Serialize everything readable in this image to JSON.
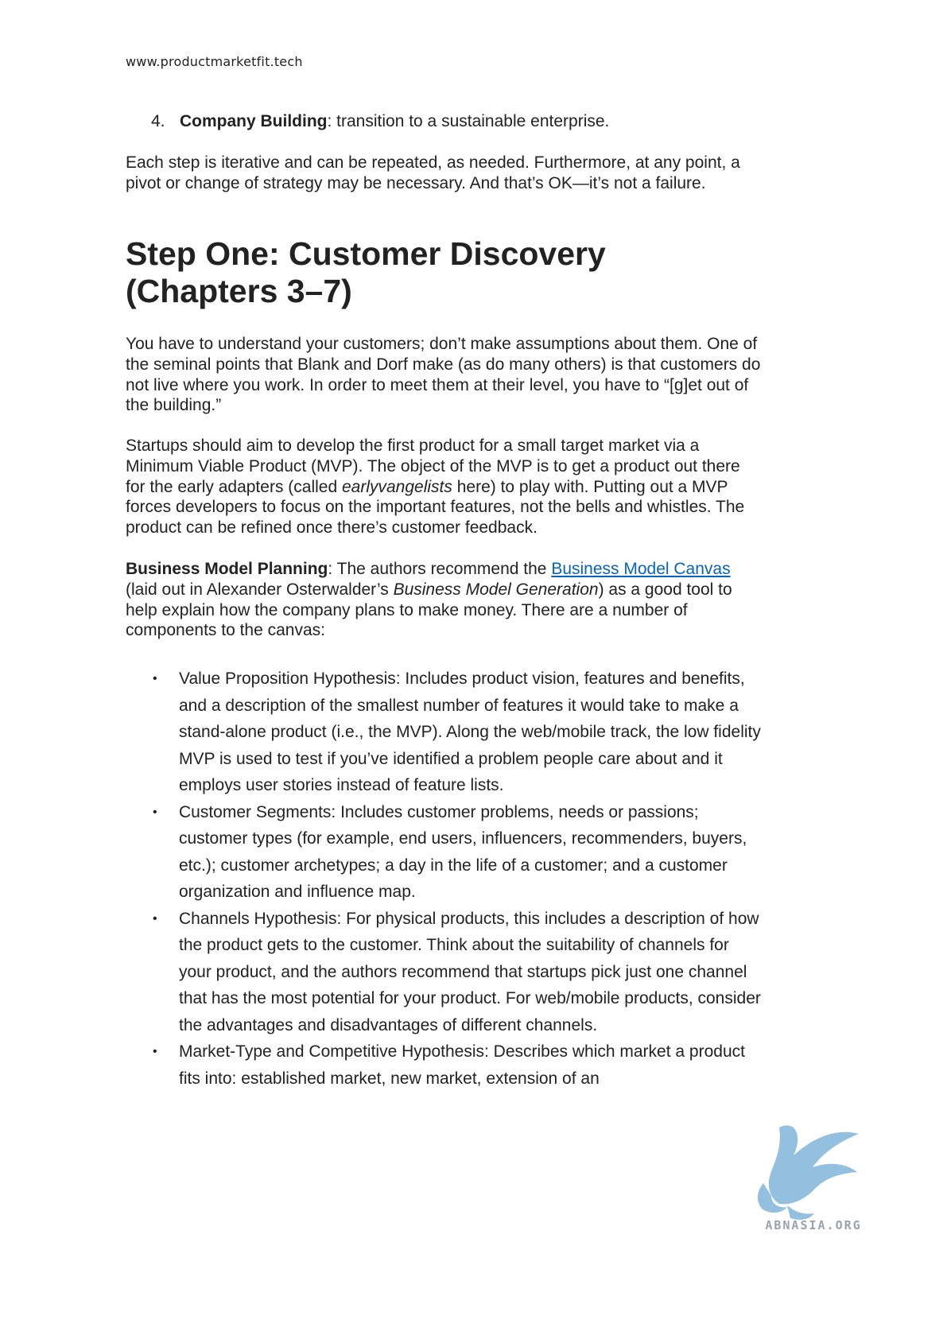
{
  "header": {
    "site_url": "www.productmarketfit.tech"
  },
  "numbered_item": {
    "number": "4.",
    "term": "Company Building",
    "text": ": transition to a sustainable enterprise."
  },
  "intro_paragraph": "Each step is iterative and can be repeated, as needed. Furthermore, at any point, a pivot or change of strategy may be necessary. And that’s OK—it’s not a failure.",
  "heading": {
    "line1": "Step One: Customer Discovery",
    "line2": "(Chapters 3–7)"
  },
  "paragraph_understand": "You have to understand your customers; don’t make assumptions about them. One of the seminal points that Blank and Dorf make (as do many others) is that customers do not live where you work. In order to meet them at their level, you have to “[g]et out of the building.”",
  "paragraph_startups": {
    "before_em": "Startups should aim to develop the first product for a small target market via a Minimum Viable Product (MVP). The object of the MVP is to get a product out there for the early adapters (called ",
    "em": "earlyvangelists",
    "after_em": " here) to play with. Putting out a MVP forces developers to focus on the important features, not the bells and whistles. The product can be refined once there’s customer feedback."
  },
  "paragraph_bmp": {
    "term": "Business Model Planning",
    "text1": ": The authors recommend the ",
    "link_text": "Business Model Canvas",
    "text2": " (laid out in Alexander Osterwalder’s ",
    "book": "Business Model Generation",
    "text3": ") as a good tool to help explain how the company plans to make money. There are a number of components to the canvas:"
  },
  "bullets": [
    "Value Proposition Hypothesis: Includes product vision, features and benefits, and a description of the smallest number of features it would take to make a stand-alone product (i.e., the MVP). Along the web/mobile track, the low fidelity MVP is used to test if you’ve identified a problem people care about and it employs user stories instead of feature lists.",
    "Customer Segments: Includes customer problems, needs or passions; customer types (for example, end users, influencers, recommenders, buyers, etc.); customer archetypes; a day in the life of a customer; and a customer organization and influence map.",
    "Channels Hypothesis: For physical products, this includes a description of how the product gets to the customer. Think about the suitability of channels for your product, and the authors recommend that startups pick just one channel that has the most potential for your product. For web/mobile products, consider the advantages and disadvantages of different channels.",
    "Market-Type and Competitive Hypothesis: Describes which market a product fits into: established market, new market, extension of an"
  ],
  "bullet_symbol": "•",
  "watermark": {
    "text": "ABNASIA.ORG",
    "color": "#7fb6d9"
  }
}
